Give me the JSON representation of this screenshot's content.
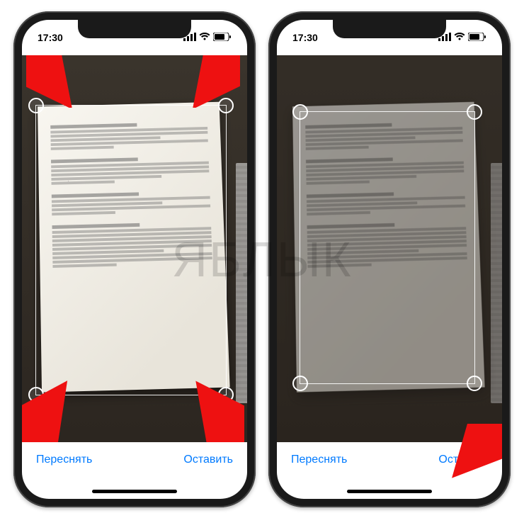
{
  "status": {
    "time": "17:30"
  },
  "buttons": {
    "retake": "Переснять",
    "keep": "Оставить"
  },
  "watermark": "ЯБЛЫК",
  "icons": {
    "signal": "signal-icon",
    "wifi": "wifi-icon",
    "battery": "battery-icon"
  }
}
